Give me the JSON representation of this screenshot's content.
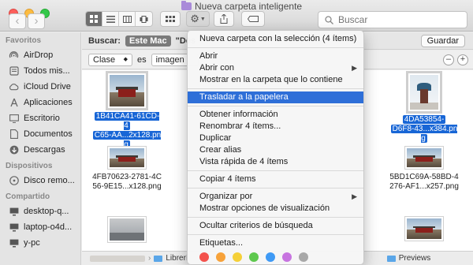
{
  "window": {
    "title": "Nueva carpeta inteligente"
  },
  "toolbar": {
    "nav_back": "‹",
    "nav_forward": "›",
    "search_placeholder": "Buscar"
  },
  "sidebar": {
    "sections": [
      {
        "title": "Favoritos",
        "items": [
          {
            "label": "AirDrop",
            "icon": "airdrop-icon"
          },
          {
            "label": "Todos mis...",
            "icon": "all-files-icon"
          },
          {
            "label": "iCloud Drive",
            "icon": "cloud-icon"
          },
          {
            "label": "Aplicaciones",
            "icon": "applications-icon"
          },
          {
            "label": "Escritorio",
            "icon": "desktop-icon"
          },
          {
            "label": "Documentos",
            "icon": "documents-icon"
          },
          {
            "label": "Descargas",
            "icon": "downloads-icon"
          }
        ]
      },
      {
        "title": "Dispositivos",
        "items": [
          {
            "label": "Disco remo...",
            "icon": "disk-icon"
          }
        ]
      },
      {
        "title": "Compartido",
        "items": [
          {
            "label": "desktop-q...",
            "icon": "computer-icon"
          },
          {
            "label": "laptop-o4d...",
            "icon": "computer-icon"
          },
          {
            "label": "y-pc",
            "icon": "computer-icon"
          }
        ]
      }
    ]
  },
  "scope": {
    "label": "Buscar:",
    "this_mac": "Este Mac",
    "other": "\"Des",
    "save": "Guardar"
  },
  "criteria": {
    "attribute": "Clase",
    "operator": "es",
    "value": "imagen",
    "remove": "–",
    "add": "+"
  },
  "files": [
    {
      "name_lines": [
        "1B41CA41-61CD-4",
        "C65-AA...2x128.png"
      ],
      "selected": true,
      "style": "gate"
    },
    {
      "name_lines": [
        "4DA53854-",
        "D6F8-43...x384.png"
      ],
      "selected": true,
      "style": "temple"
    },
    {
      "name_lines": [
        "4FB70623-2781-4C",
        "56-9E15...x128.png"
      ],
      "selected": false,
      "style": "gate"
    },
    {
      "name_lines": [
        "5BD1C69A-58BD-4",
        "276-AF1...x257.png"
      ],
      "selected": false,
      "style": "gate"
    },
    {
      "name_lines": [],
      "selected": false,
      "style": "gray"
    },
    {
      "name_lines": [],
      "selected": false,
      "style": "gate"
    }
  ],
  "pathbar": {
    "items": [
      "Librerí",
      "Previews"
    ]
  },
  "menu": {
    "groups": [
      [
        {
          "label": "Nueva carpeta con la selección (4 ítems)"
        }
      ],
      [
        {
          "label": "Abrir"
        },
        {
          "label": "Abrir con",
          "submenu": true
        },
        {
          "label": "Mostrar en la carpeta que lo contiene"
        }
      ],
      [
        {
          "label": "Trasladar a la papelera",
          "highlighted": true
        }
      ],
      [
        {
          "label": "Obtener información"
        },
        {
          "label": "Renombrar 4 ítems..."
        },
        {
          "label": "Duplicar"
        },
        {
          "label": "Crear alias"
        },
        {
          "label": "Vista rápida de 4 ítems"
        }
      ],
      [
        {
          "label": "Copiar 4 ítems"
        }
      ],
      [
        {
          "label": "Organizar por",
          "submenu": true
        },
        {
          "label": "Mostrar opciones de visualización"
        }
      ],
      [
        {
          "label": "Ocultar criterios de búsqueda"
        }
      ],
      [
        {
          "label": "Etiquetas..."
        }
      ]
    ],
    "tag_colors": [
      "#f3524d",
      "#f7a23a",
      "#f5d038",
      "#5ec84e",
      "#3f9af5",
      "#c774e0",
      "#a8a8a8"
    ]
  },
  "colors": {
    "selection": "#1866d6",
    "menu_highlight": "#2e6fd8"
  }
}
